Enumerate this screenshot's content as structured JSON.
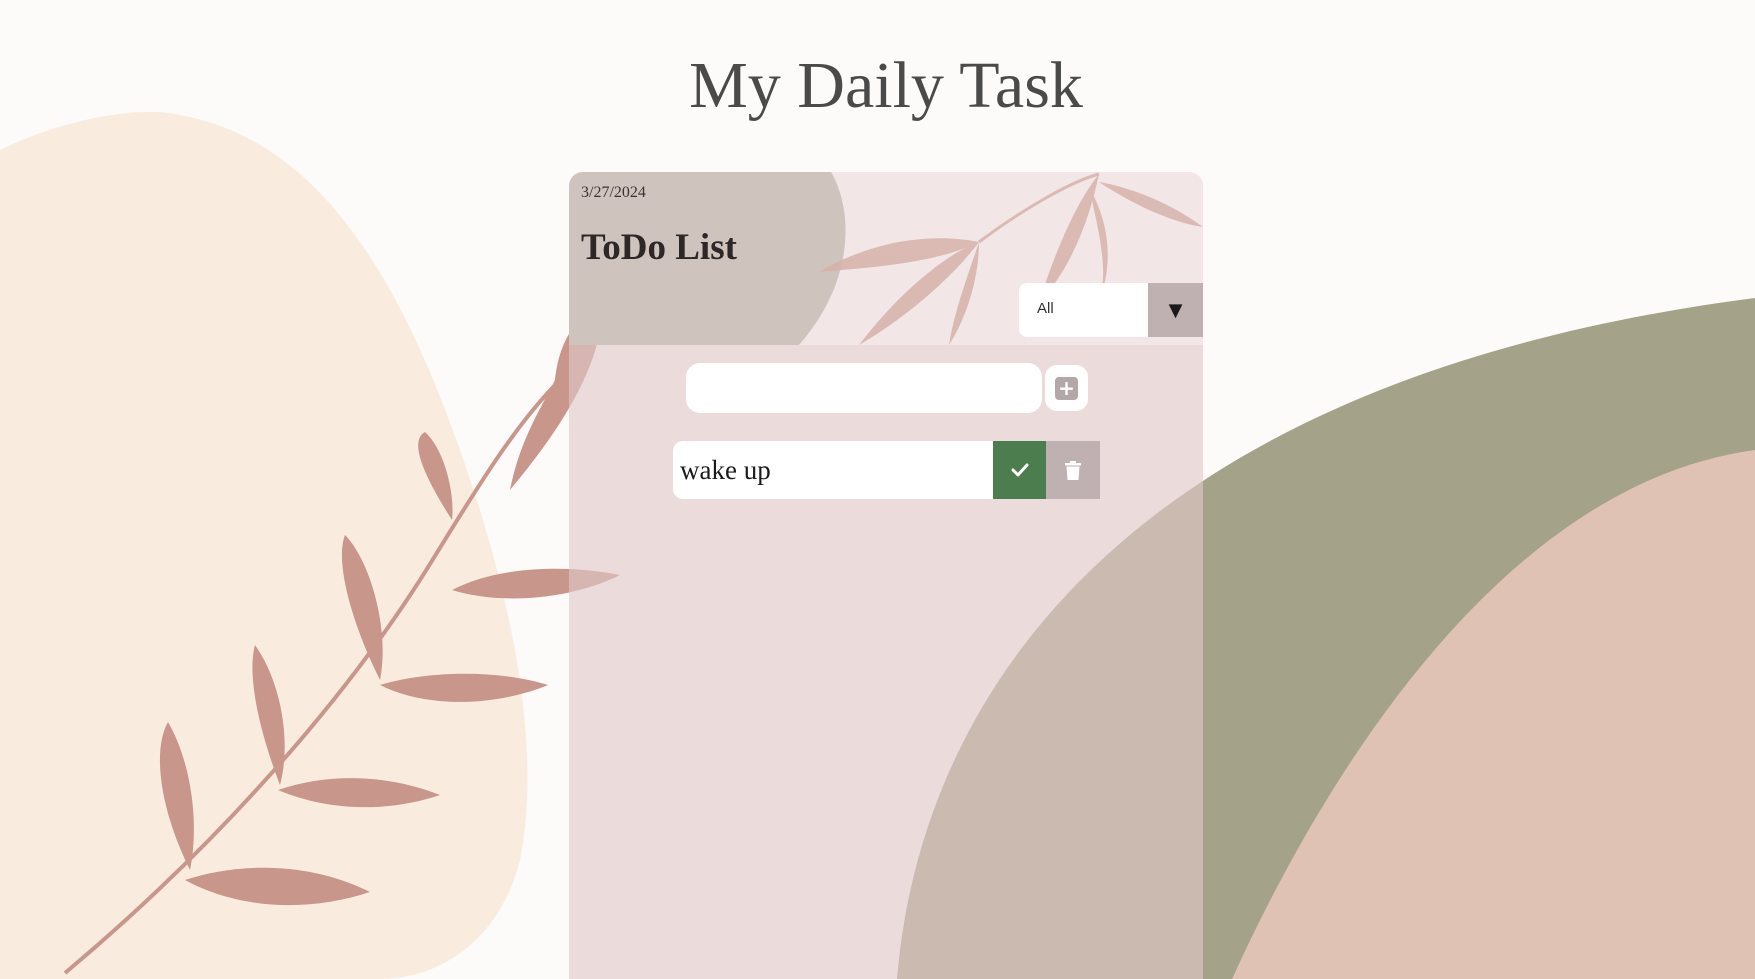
{
  "page": {
    "title": "My Daily Task"
  },
  "card": {
    "date": "3/27/2024",
    "heading": "ToDo List"
  },
  "filter": {
    "selected": "All",
    "arrow_icon": "triangle-down-icon"
  },
  "new_task": {
    "value": "",
    "placeholder": "",
    "add_icon": "plus-icon"
  },
  "tasks": [
    {
      "text": "wake up",
      "complete_icon": "check-icon",
      "delete_icon": "trash-icon"
    }
  ],
  "colors": {
    "background": "#fdfafa",
    "left_blob": "#f9ecdf",
    "branch_leaves": "#c8968a",
    "olive_arc": "#a5a28a",
    "peach_arc": "#e0c2b5",
    "card_tint": "#e8d6d7",
    "header_bg": "#f2e6e7",
    "header_blob": "#cfc3bd",
    "complete_green": "#4b7d4f",
    "neutral_button": "#bfb1b1"
  }
}
